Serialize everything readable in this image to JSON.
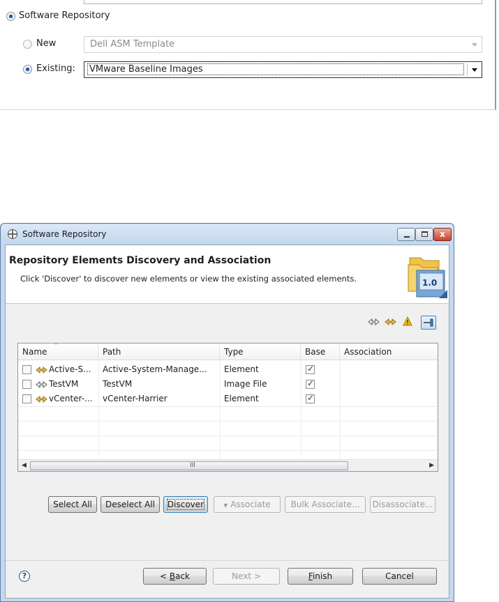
{
  "top": {
    "group_label": "Software Repository",
    "new_label": "New",
    "new_value": "Dell ASM Template",
    "existing_label": "Existing:",
    "existing_value": "VMware Baseline Images"
  },
  "dialog": {
    "title": "Software Repository",
    "window_buttons": {
      "minimize": "minimize-icon",
      "maximize": "maximize-icon",
      "close": "x"
    },
    "banner_title": "Repository Elements Discovery and Association",
    "banner_desc": "Click 'Discover' to discover new elements or view the existing associated  elements.",
    "banner_version": "1.0",
    "toolbar_icons": [
      "element-filter-icon",
      "element-new-icon",
      "warning-icon",
      "association-toggle-icon"
    ],
    "table": {
      "headers": [
        "Name",
        "Path",
        "Type",
        "Base",
        "Association"
      ],
      "rows": [
        {
          "name": "Active-S...",
          "path": "Active-System-Manage...",
          "type": "Element",
          "base": true,
          "association": ""
        },
        {
          "name": "TestVM",
          "path": "TestVM",
          "type": "Image File",
          "base": true,
          "association": ""
        },
        {
          "name": "vCenter-...",
          "path": "vCenter-Harrier",
          "type": "Element",
          "base": true,
          "association": ""
        }
      ],
      "scroll_grip": "III"
    },
    "actions": {
      "select_all": "Select All",
      "deselect_all": "Deselect All",
      "discover": "Discover",
      "associate": "Associate",
      "bulk_associate": "Bulk Associate...",
      "disassociate": "Disassociate..."
    },
    "nav": {
      "help": "?",
      "back_prefix": "< ",
      "back_key": "B",
      "back_rest": "ack",
      "next": "Next >",
      "finish_key": "F",
      "finish_rest": "inish",
      "cancel": "Cancel"
    },
    "colors": {
      "accent": "#1e5bb5",
      "titlebar": "#c4d7ee",
      "close": "#c8432c",
      "warning": "#e8b100"
    }
  }
}
